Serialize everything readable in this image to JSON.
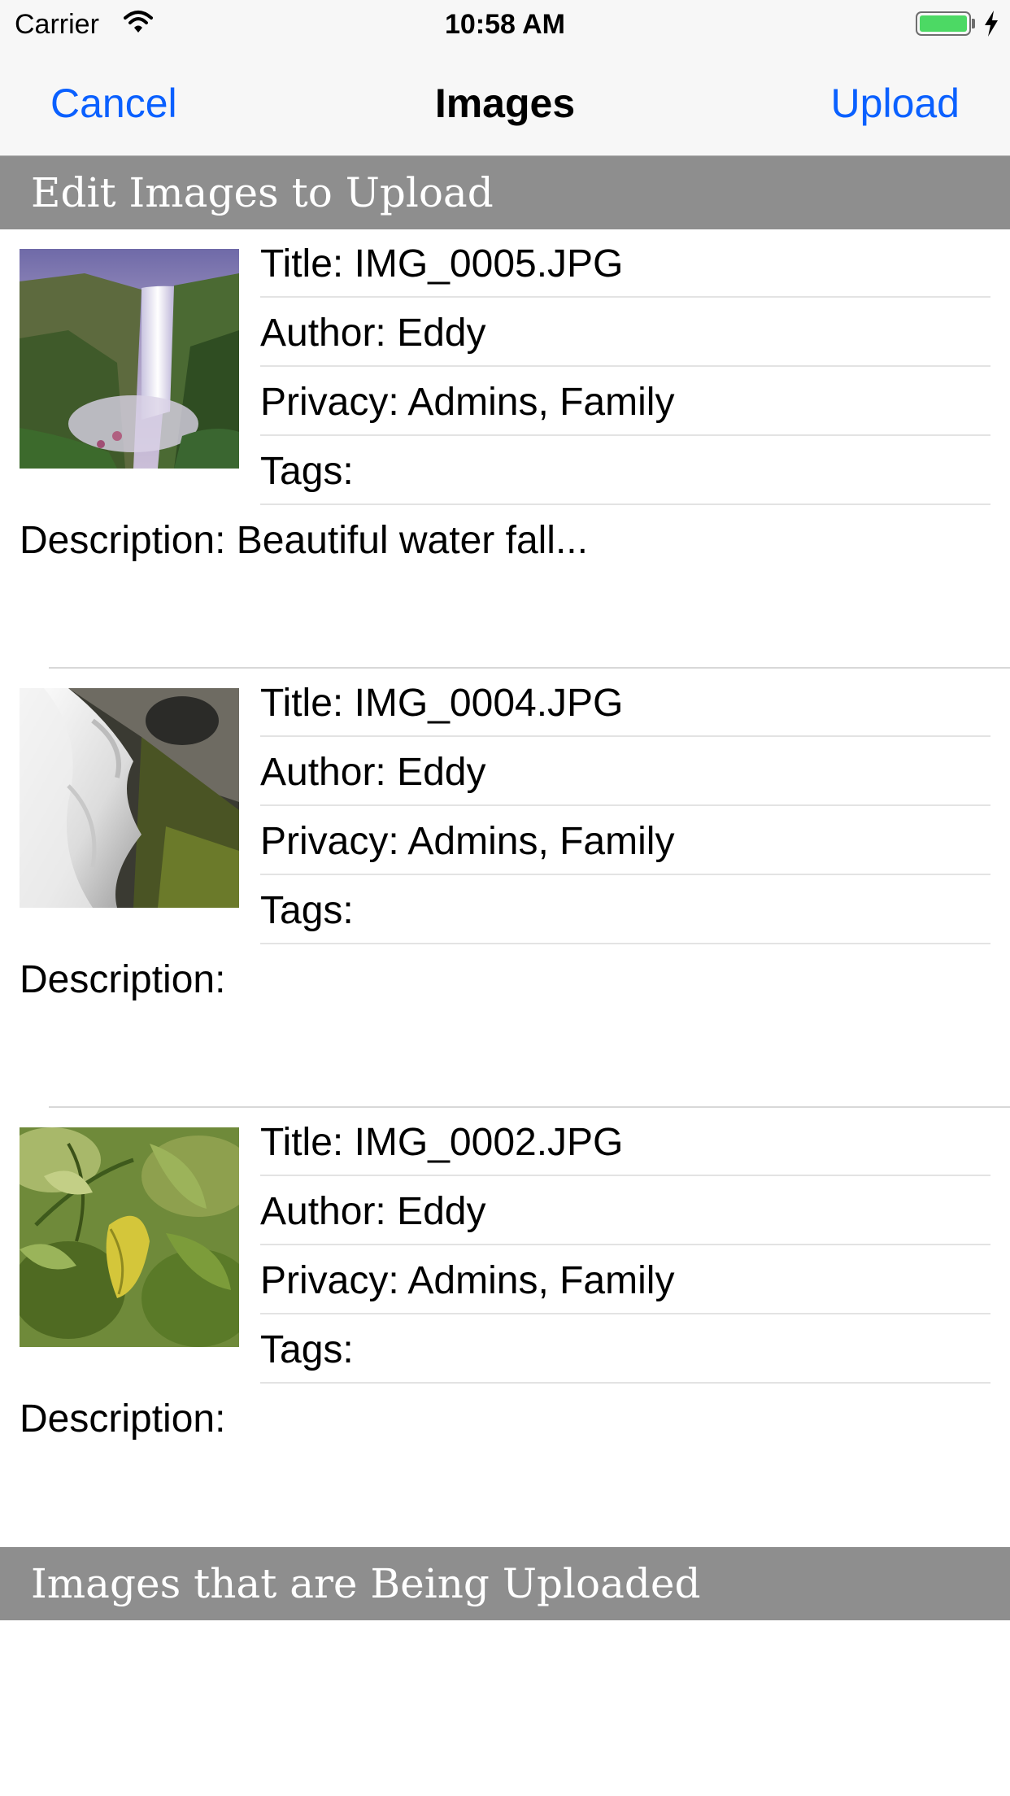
{
  "status_bar": {
    "carrier": "Carrier",
    "time": "10:58 AM",
    "battery_color": "#4cd964",
    "icons": [
      "wifi-icon",
      "battery-icon",
      "charging-bolt-icon"
    ]
  },
  "nav": {
    "cancel_label": "Cancel",
    "title": "Images",
    "upload_label": "Upload",
    "tint_color": "#0a60ff"
  },
  "sections": {
    "edit_header": "Edit Images to Upload",
    "uploading_header": "Images that are Being Uploaded"
  },
  "images": [
    {
      "thumbnail": "waterfall-misty-cliff",
      "title": "Title: IMG_0005.JPG",
      "author": "Author: Eddy",
      "privacy": "Privacy: Admins, Family",
      "tags": "Tags:",
      "description": "Description: Beautiful water fall..."
    },
    {
      "thumbnail": "waterfall-rocks",
      "title": "Title: IMG_0004.JPG",
      "author": "Author: Eddy",
      "privacy": "Privacy: Admins, Family",
      "tags": "Tags:",
      "description": "Description:"
    },
    {
      "thumbnail": "green-leaves",
      "title": "Title: IMG_0002.JPG",
      "author": "Author: Eddy",
      "privacy": "Privacy: Admins, Family",
      "tags": "Tags:",
      "description": "Description:"
    }
  ]
}
